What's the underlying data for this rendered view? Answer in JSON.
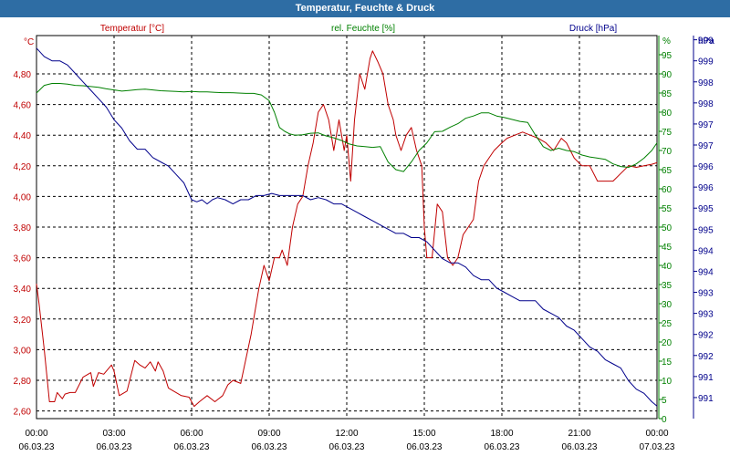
{
  "window": {
    "title": "Temperatur, Feuchte & Druck"
  },
  "chart_data": {
    "type": "line",
    "title": "Temperatur, Feuchte & Druck",
    "grid": true,
    "x_tick_labels": [
      {
        "time": "00:00",
        "date": "06.03.23"
      },
      {
        "time": "03:00",
        "date": "06.03.23"
      },
      {
        "time": "06:00",
        "date": "06.03.23"
      },
      {
        "time": "09:00",
        "date": "06.03.23"
      },
      {
        "time": "12:00",
        "date": "06.03.23"
      },
      {
        "time": "15:00",
        "date": "06.03.23"
      },
      {
        "time": "18:00",
        "date": "06.03.23"
      },
      {
        "time": "21:00",
        "date": "06.03.23"
      },
      {
        "time": "00:00",
        "date": "07.03.23"
      }
    ],
    "x_range_hours": [
      0,
      24
    ],
    "axes": {
      "temperature": {
        "label": "Temperatur [°C]",
        "unit": "°C",
        "color": "#c00000",
        "side": "left",
        "range": [
          2.55,
          5.05
        ],
        "ticks": [
          "2,60",
          "2,80",
          "3,00",
          "3,20",
          "3,40",
          "3,60",
          "3,80",
          "4,00",
          "4,20",
          "4,40",
          "4,60",
          "4,80"
        ]
      },
      "humidity": {
        "label": "rel. Feuchte [%]",
        "unit": "%",
        "color": "#008000",
        "side": "right",
        "range": [
          0,
          100
        ],
        "ticks": [
          "0",
          "5",
          "10",
          "15",
          "20",
          "25",
          "30",
          "35",
          "40",
          "45",
          "50",
          "55",
          "60",
          "65",
          "70",
          "75",
          "80",
          "85",
          "90",
          "95"
        ]
      },
      "pressure": {
        "label": "Druck [hPa]",
        "unit": "hPa",
        "color": "#00008b",
        "side": "right",
        "range": [
          990.5,
          999.6
        ],
        "ticks": [
          "991",
          "991",
          "992",
          "992",
          "993",
          "993",
          "994",
          "994",
          "995",
          "995",
          "996",
          "996",
          "997",
          "997",
          "998",
          "998",
          "999",
          "999"
        ]
      }
    },
    "series": [
      {
        "name": "Temperatur [°C]",
        "axis": "temperature",
        "color": "#c00000",
        "x": [
          0,
          0.1,
          0.3,
          0.5,
          0.7,
          0.8,
          1.0,
          1.1,
          1.3,
          1.5,
          1.8,
          2.1,
          2.2,
          2.4,
          2.6,
          2.9,
          3.0,
          3.2,
          3.5,
          3.8,
          4.0,
          4.2,
          4.4,
          4.6,
          4.7,
          4.9,
          5.1,
          5.3,
          5.6,
          5.9,
          6.1,
          6.3,
          6.6,
          6.9,
          7.2,
          7.4,
          7.6,
          7.9,
          8.3,
          8.6,
          8.8,
          9.0,
          9.2,
          9.4,
          9.5,
          9.7,
          9.9,
          10.1,
          10.3,
          10.5,
          10.7,
          10.9,
          11.1,
          11.3,
          11.5,
          11.7,
          11.9,
          12.0,
          12.15,
          12.3,
          12.5,
          12.7,
          12.9,
          13.0,
          13.2,
          13.4,
          13.6,
          13.8,
          13.9,
          14.1,
          14.3,
          14.5,
          14.7,
          14.9,
          15.0,
          15.1,
          15.3,
          15.5,
          15.7,
          15.9,
          16.1,
          16.3,
          16.5,
          16.7,
          16.9,
          17.1,
          17.3,
          17.5,
          17.7,
          18.0,
          18.2,
          18.5,
          18.8,
          19.1,
          19.4,
          19.7,
          20.0,
          20.3,
          20.5,
          20.8,
          21.1,
          21.4,
          21.7,
          21.9,
          22.1,
          22.3,
          22.6,
          22.9,
          23.2,
          23.5,
          23.8,
          24.0
        ],
        "values": [
          3.43,
          3.3,
          3.0,
          2.66,
          2.66,
          2.72,
          2.68,
          2.71,
          2.72,
          2.72,
          2.82,
          2.85,
          2.76,
          2.85,
          2.84,
          2.9,
          2.86,
          2.7,
          2.73,
          2.93,
          2.9,
          2.88,
          2.92,
          2.86,
          2.92,
          2.86,
          2.75,
          2.73,
          2.7,
          2.69,
          2.63,
          2.66,
          2.7,
          2.66,
          2.7,
          2.77,
          2.8,
          2.78,
          3.1,
          3.4,
          3.55,
          3.45,
          3.6,
          3.6,
          3.65,
          3.55,
          3.8,
          3.95,
          4.0,
          4.2,
          4.35,
          4.55,
          4.6,
          4.5,
          4.3,
          4.5,
          4.3,
          4.4,
          4.1,
          4.5,
          4.8,
          4.7,
          4.9,
          4.95,
          4.88,
          4.8,
          4.6,
          4.5,
          4.4,
          4.3,
          4.4,
          4.45,
          4.3,
          4.2,
          3.8,
          3.6,
          3.6,
          3.95,
          3.9,
          3.6,
          3.55,
          3.6,
          3.75,
          3.8,
          3.85,
          4.1,
          4.2,
          4.25,
          4.3,
          4.35,
          4.38,
          4.4,
          4.42,
          4.4,
          4.38,
          4.35,
          4.3,
          4.38,
          4.35,
          4.25,
          4.2,
          4.2,
          4.1,
          4.1,
          4.1,
          4.1,
          4.15,
          4.2,
          4.19,
          4.2,
          4.21,
          4.22
        ]
      },
      {
        "name": "rel. Feuchte [%]",
        "axis": "humidity",
        "color": "#008000",
        "x": [
          0,
          0.3,
          0.6,
          0.9,
          1.2,
          1.5,
          1.8,
          2.1,
          2.4,
          2.7,
          3.0,
          3.3,
          3.6,
          3.9,
          4.2,
          4.5,
          4.8,
          5.1,
          5.4,
          5.7,
          6.0,
          6.3,
          6.6,
          6.9,
          7.2,
          7.5,
          7.8,
          8.1,
          8.4,
          8.7,
          9.0,
          9.2,
          9.4,
          9.6,
          9.8,
          10.0,
          10.3,
          10.6,
          10.9,
          11.2,
          11.5,
          11.8,
          12.1,
          12.4,
          12.7,
          13.0,
          13.3,
          13.6,
          13.9,
          14.2,
          14.5,
          14.8,
          15.1,
          15.4,
          15.7,
          16.0,
          16.3,
          16.6,
          16.9,
          17.2,
          17.5,
          17.8,
          18.1,
          18.4,
          18.7,
          19.0,
          19.3,
          19.6,
          19.9,
          20.2,
          20.5,
          20.8,
          21.1,
          21.4,
          21.7,
          22.0,
          22.3,
          22.6,
          22.9,
          23.2,
          23.5,
          23.8,
          24.0
        ],
        "values": [
          85,
          87,
          87.5,
          87.5,
          87.3,
          87,
          86.9,
          86.7,
          86.5,
          86.1,
          85.8,
          85.5,
          85.7,
          85.9,
          86,
          85.8,
          85.6,
          85.5,
          85.4,
          85.3,
          85.4,
          85.3,
          85.3,
          85.2,
          85.1,
          85.1,
          85.0,
          84.9,
          84.9,
          84.5,
          83,
          80,
          76,
          75,
          74.3,
          74.0,
          74.1,
          74.5,
          74.6,
          73.8,
          73.3,
          72.6,
          71.7,
          71.2,
          71.0,
          70.8,
          71.0,
          67,
          65,
          64.5,
          67,
          70,
          72,
          74.9,
          75,
          76.1,
          77,
          78.4,
          79,
          79.8,
          79.8,
          79.0,
          78.6,
          78.1,
          77.6,
          77.3,
          74,
          71,
          70,
          70.6,
          70.0,
          69.7,
          68.8,
          68.3,
          68.0,
          67.7,
          66.5,
          65.8,
          65.6,
          66.5,
          68,
          70,
          72
        ]
      },
      {
        "name": "Druck [hPa]",
        "axis": "pressure",
        "color": "#00008b",
        "x": [
          0,
          0.3,
          0.6,
          0.9,
          1.2,
          1.5,
          1.8,
          2.1,
          2.4,
          2.7,
          3.0,
          3.3,
          3.6,
          3.9,
          4.2,
          4.5,
          4.8,
          5.1,
          5.4,
          5.7,
          6.0,
          6.2,
          6.4,
          6.6,
          6.8,
          7.0,
          7.3,
          7.6,
          7.9,
          8.2,
          8.5,
          8.8,
          9.1,
          9.4,
          9.7,
          10.0,
          10.3,
          10.6,
          10.9,
          11.2,
          11.5,
          11.8,
          12.1,
          12.4,
          12.7,
          13.0,
          13.3,
          13.6,
          13.9,
          14.2,
          14.5,
          14.8,
          15.1,
          15.4,
          15.7,
          16.0,
          16.3,
          16.6,
          16.9,
          17.2,
          17.5,
          17.8,
          18.1,
          18.4,
          18.7,
          19.0,
          19.3,
          19.6,
          19.9,
          20.2,
          20.5,
          20.8,
          21.1,
          21.4,
          21.7,
          22.0,
          22.3,
          22.6,
          22.9,
          23.2,
          23.5,
          23.8,
          24.0
        ],
        "values": [
          999.3,
          999.1,
          999.0,
          999.0,
          998.9,
          998.7,
          998.5,
          998.3,
          998.1,
          997.9,
          997.6,
          997.4,
          997.1,
          996.9,
          996.9,
          996.7,
          996.6,
          996.5,
          996.3,
          996.1,
          995.7,
          995.65,
          995.7,
          995.6,
          995.7,
          995.75,
          995.7,
          995.6,
          995.7,
          995.7,
          995.8,
          995.8,
          995.85,
          995.8,
          995.8,
          995.8,
          995.8,
          995.7,
          995.75,
          995.7,
          995.6,
          995.6,
          995.5,
          995.4,
          995.3,
          995.2,
          995.1,
          995.0,
          994.9,
          994.9,
          994.8,
          994.8,
          994.7,
          994.5,
          994.3,
          994.2,
          994.2,
          994.1,
          993.9,
          993.8,
          993.8,
          993.6,
          993.5,
          993.4,
          993.3,
          993.3,
          993.3,
          993.1,
          993.0,
          992.9,
          992.7,
          992.6,
          992.4,
          992.2,
          992.1,
          991.9,
          991.8,
          991.7,
          991.4,
          991.2,
          991.1,
          990.9,
          990.8
        ]
      }
    ]
  }
}
